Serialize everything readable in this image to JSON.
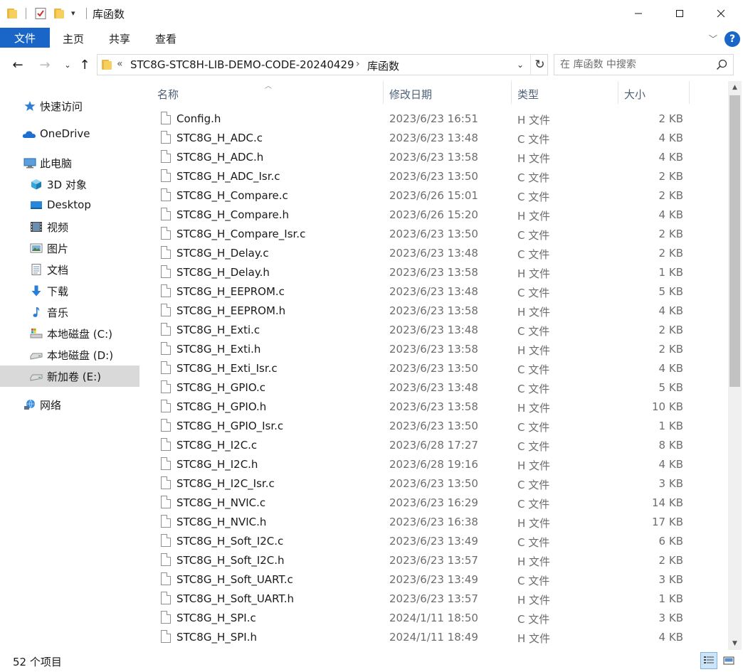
{
  "window": {
    "title": "库函数",
    "minimize_icon": "minimize-icon",
    "maximize_icon": "maximize-icon",
    "close_icon": "close-icon"
  },
  "ribbon": {
    "tabs": [
      {
        "label": "文件",
        "active": true
      },
      {
        "label": "主页"
      },
      {
        "label": "共享"
      },
      {
        "label": "查看"
      }
    ],
    "help_label": "?",
    "accent_color": "#1a66c8"
  },
  "address": {
    "overflow": "«",
    "crumbs": [
      "STC8G-STC8H-LIB-DEMO-CODE-20240429",
      "库函数"
    ],
    "separator": "›"
  },
  "search": {
    "placeholder": "在 库函数 中搜索",
    "value": ""
  },
  "nav": {
    "items": [
      {
        "label": "快速访问",
        "icon": "star-icon"
      },
      {
        "label": "OneDrive",
        "icon": "cloud-icon"
      },
      {
        "label": "此电脑",
        "icon": "computer-icon"
      },
      {
        "label": "3D 对象",
        "icon": "cube-icon"
      },
      {
        "label": "Desktop",
        "icon": "desktop-icon"
      },
      {
        "label": "视频",
        "icon": "video-icon"
      },
      {
        "label": "图片",
        "icon": "pictures-icon"
      },
      {
        "label": "文档",
        "icon": "document-icon"
      },
      {
        "label": "下载",
        "icon": "download-icon"
      },
      {
        "label": "音乐",
        "icon": "music-icon"
      },
      {
        "label": "本地磁盘 (C:)",
        "icon": "windows-drive-icon"
      },
      {
        "label": "本地磁盘 (D:)",
        "icon": "drive-icon"
      },
      {
        "label": "新加卷 (E:)",
        "icon": "drive-icon",
        "selected": true
      },
      {
        "label": "网络",
        "icon": "network-icon"
      }
    ]
  },
  "columns": {
    "name": "名称",
    "date": "修改日期",
    "type": "类型",
    "size": "大小"
  },
  "files": [
    {
      "name": "Config.h",
      "date": "2023/6/23 16:51",
      "type": "H 文件",
      "size": "2 KB"
    },
    {
      "name": "STC8G_H_ADC.c",
      "date": "2023/6/23 13:48",
      "type": "C 文件",
      "size": "4 KB"
    },
    {
      "name": "STC8G_H_ADC.h",
      "date": "2023/6/23 13:58",
      "type": "H 文件",
      "size": "4 KB"
    },
    {
      "name": "STC8G_H_ADC_Isr.c",
      "date": "2023/6/23 13:50",
      "type": "C 文件",
      "size": "2 KB"
    },
    {
      "name": "STC8G_H_Compare.c",
      "date": "2023/6/26 15:01",
      "type": "C 文件",
      "size": "2 KB"
    },
    {
      "name": "STC8G_H_Compare.h",
      "date": "2023/6/26 15:20",
      "type": "H 文件",
      "size": "4 KB"
    },
    {
      "name": "STC8G_H_Compare_Isr.c",
      "date": "2023/6/23 13:50",
      "type": "C 文件",
      "size": "2 KB"
    },
    {
      "name": "STC8G_H_Delay.c",
      "date": "2023/6/23 13:48",
      "type": "C 文件",
      "size": "2 KB"
    },
    {
      "name": "STC8G_H_Delay.h",
      "date": "2023/6/23 13:58",
      "type": "H 文件",
      "size": "1 KB"
    },
    {
      "name": "STC8G_H_EEPROM.c",
      "date": "2023/6/23 13:48",
      "type": "C 文件",
      "size": "5 KB"
    },
    {
      "name": "STC8G_H_EEPROM.h",
      "date": "2023/6/23 13:58",
      "type": "H 文件",
      "size": "4 KB"
    },
    {
      "name": "STC8G_H_Exti.c",
      "date": "2023/6/23 13:48",
      "type": "C 文件",
      "size": "2 KB"
    },
    {
      "name": "STC8G_H_Exti.h",
      "date": "2023/6/23 13:58",
      "type": "H 文件",
      "size": "2 KB"
    },
    {
      "name": "STC8G_H_Exti_Isr.c",
      "date": "2023/6/23 13:50",
      "type": "C 文件",
      "size": "4 KB"
    },
    {
      "name": "STC8G_H_GPIO.c",
      "date": "2023/6/23 13:48",
      "type": "C 文件",
      "size": "5 KB"
    },
    {
      "name": "STC8G_H_GPIO.h",
      "date": "2023/6/23 13:58",
      "type": "H 文件",
      "size": "10 KB"
    },
    {
      "name": "STC8G_H_GPIO_Isr.c",
      "date": "2023/6/23 13:50",
      "type": "C 文件",
      "size": "1 KB"
    },
    {
      "name": "STC8G_H_I2C.c",
      "date": "2023/6/28 17:27",
      "type": "C 文件",
      "size": "8 KB"
    },
    {
      "name": "STC8G_H_I2C.h",
      "date": "2023/6/28 19:16",
      "type": "H 文件",
      "size": "4 KB"
    },
    {
      "name": "STC8G_H_I2C_Isr.c",
      "date": "2023/6/23 13:50",
      "type": "C 文件",
      "size": "3 KB"
    },
    {
      "name": "STC8G_H_NVIC.c",
      "date": "2023/6/23 16:29",
      "type": "C 文件",
      "size": "14 KB"
    },
    {
      "name": "STC8G_H_NVIC.h",
      "date": "2023/6/23 16:38",
      "type": "H 文件",
      "size": "17 KB"
    },
    {
      "name": "STC8G_H_Soft_I2C.c",
      "date": "2023/6/23 13:49",
      "type": "C 文件",
      "size": "6 KB"
    },
    {
      "name": "STC8G_H_Soft_I2C.h",
      "date": "2023/6/23 13:57",
      "type": "H 文件",
      "size": "2 KB"
    },
    {
      "name": "STC8G_H_Soft_UART.c",
      "date": "2023/6/23 13:49",
      "type": "C 文件",
      "size": "3 KB"
    },
    {
      "name": "STC8G_H_Soft_UART.h",
      "date": "2023/6/23 13:57",
      "type": "H 文件",
      "size": "1 KB"
    },
    {
      "name": "STC8G_H_SPI.c",
      "date": "2024/1/11 18:50",
      "type": "C 文件",
      "size": "3 KB"
    },
    {
      "name": "STC8G_H_SPI.h",
      "date": "2024/1/11 18:49",
      "type": "H 文件",
      "size": "4 KB"
    }
  ],
  "status": {
    "count": "52 个项目"
  }
}
